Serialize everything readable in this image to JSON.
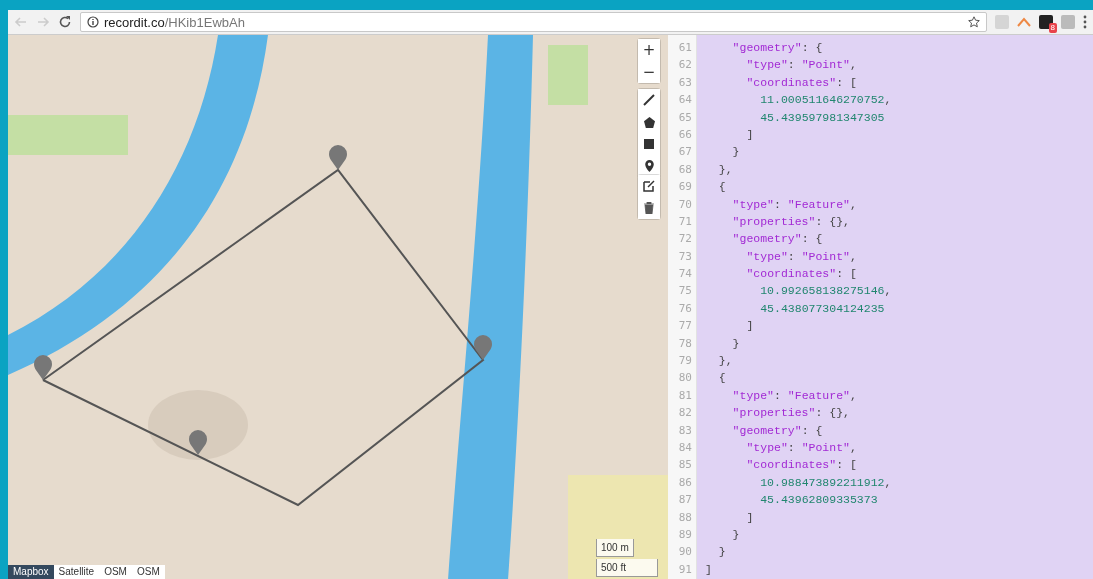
{
  "browser": {
    "url_host": "recordit.co",
    "url_path": "/HKib1EwbAh",
    "extension_badge": "8"
  },
  "map": {
    "zoom_controls": [
      "+",
      "−"
    ],
    "scale": [
      "100 m",
      "500 ft"
    ],
    "layers": [
      {
        "label": "Mapbox",
        "selected": true
      },
      {
        "label": "Satellite",
        "selected": false
      },
      {
        "label": "OSM",
        "selected": false
      },
      {
        "label": "OSM",
        "selected": false
      }
    ]
  },
  "editor": {
    "lines": [
      {
        "number": "61",
        "text": "    \"geometry\": {"
      },
      {
        "number": "62",
        "text": "      \"type\": \"Point\","
      },
      {
        "number": "63",
        "text": "      \"coordinates\": ["
      },
      {
        "number": "64",
        "text": "        11.000511646270752,"
      },
      {
        "number": "65",
        "text": "        45.439597981347305"
      },
      {
        "number": "66",
        "text": "      ]"
      },
      {
        "number": "67",
        "text": "    }"
      },
      {
        "number": "68",
        "text": "  },"
      },
      {
        "number": "69",
        "text": "  {"
      },
      {
        "number": "70",
        "text": "    \"type\": \"Feature\","
      },
      {
        "number": "71",
        "text": "    \"properties\": {},"
      },
      {
        "number": "72",
        "text": "    \"geometry\": {"
      },
      {
        "number": "73",
        "text": "      \"type\": \"Point\","
      },
      {
        "number": "74",
        "text": "      \"coordinates\": ["
      },
      {
        "number": "75",
        "text": "        10.992658138275146,"
      },
      {
        "number": "76",
        "text": "        45.438077304124235"
      },
      {
        "number": "77",
        "text": "      ]"
      },
      {
        "number": "78",
        "text": "    }"
      },
      {
        "number": "79",
        "text": "  },"
      },
      {
        "number": "80",
        "text": "  {"
      },
      {
        "number": "81",
        "text": "    \"type\": \"Feature\","
      },
      {
        "number": "82",
        "text": "    \"properties\": {},"
      },
      {
        "number": "83",
        "text": "    \"geometry\": {"
      },
      {
        "number": "84",
        "text": "      \"type\": \"Point\","
      },
      {
        "number": "85",
        "text": "      \"coordinates\": ["
      },
      {
        "number": "86",
        "text": "        10.988473892211912,"
      },
      {
        "number": "87",
        "text": "        45.43962809335373"
      },
      {
        "number": "88",
        "text": "      ]"
      },
      {
        "number": "89",
        "text": "    }"
      },
      {
        "number": "90",
        "text": "  }"
      },
      {
        "number": "91",
        "text": "]"
      }
    ]
  }
}
